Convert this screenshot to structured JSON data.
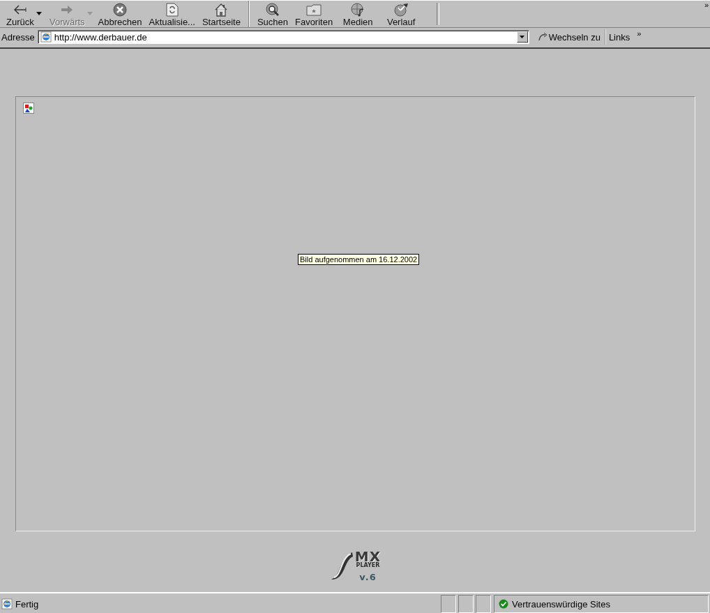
{
  "toolbar": {
    "buttons": [
      {
        "label": "Zurück",
        "disabled": false,
        "dropdown": true
      },
      {
        "label": "Vorwärts",
        "disabled": true,
        "dropdown": true
      },
      {
        "label": "Abbrechen",
        "disabled": false,
        "dropdown": false
      },
      {
        "label": "Aktualisie...",
        "disabled": false,
        "dropdown": false
      },
      {
        "label": "Startseite",
        "disabled": false,
        "dropdown": false
      },
      {
        "label": "Suchen",
        "disabled": false,
        "dropdown": false,
        "group_start": true
      },
      {
        "label": "Favoriten",
        "disabled": false,
        "dropdown": false
      },
      {
        "label": "Medien",
        "disabled": false,
        "dropdown": false
      },
      {
        "label": "Verlauf",
        "disabled": false,
        "dropdown": false
      }
    ],
    "more": "»"
  },
  "address_bar": {
    "label": "Adresse",
    "value": "http://www.derbauer.de",
    "go": "Wechseln zu",
    "links": "Links",
    "links_more": "»"
  },
  "content": {
    "tooltip": "Bild aufgenommen am 16.12.2002",
    "logo": {
      "title": "MX",
      "subtitle": "PLAYER",
      "version": "v.6"
    }
  },
  "status_bar": {
    "text": "Fertig",
    "zone": "Vertrauenswürdige Sites"
  }
}
